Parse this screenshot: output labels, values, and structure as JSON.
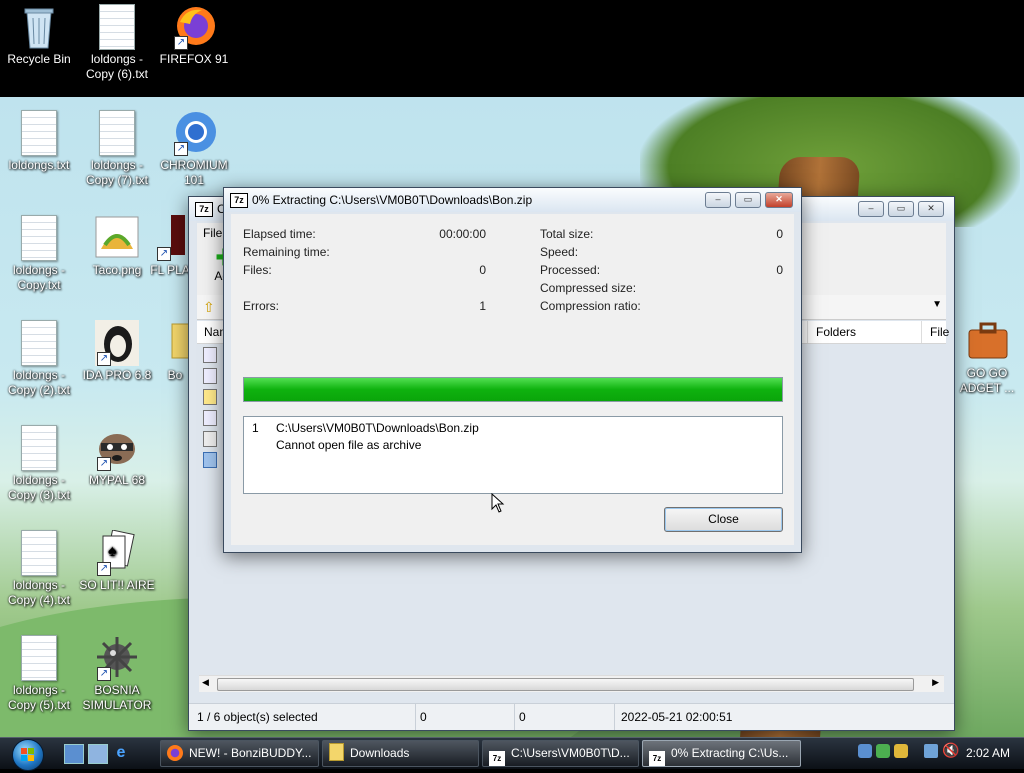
{
  "desktop": {
    "icons": [
      {
        "label": "Recycle Bin",
        "icon": "recycle-bin-icon"
      },
      {
        "label": "loldongs - Copy (6).txt",
        "icon": "text-file-icon"
      },
      {
        "label": "FIREFOX 91",
        "icon": "firefox-icon"
      },
      {
        "label": "loldongs.txt",
        "icon": "text-file-icon"
      },
      {
        "label": "loldongs - Copy (7).txt",
        "icon": "text-file-icon"
      },
      {
        "label": "CHROMIUM 101",
        "icon": "chromium-icon"
      },
      {
        "label": "loldongs - Copy.txt",
        "icon": "text-file-icon"
      },
      {
        "label": "Taco.png",
        "icon": "image-file-icon"
      },
      {
        "label": "FL PLA",
        "icon": "app-icon"
      },
      {
        "label": "loldongs - Copy (2).txt",
        "icon": "text-file-icon"
      },
      {
        "label": "IDA PRO 6.8",
        "icon": "ida-pro-icon"
      },
      {
        "label": "Bo",
        "icon": "folder-icon"
      },
      {
        "label": "loldongs - Copy (3).txt",
        "icon": "text-file-icon"
      },
      {
        "label": "MYPAL 68",
        "icon": "mypal-icon"
      },
      {
        "label": "loldongs - Copy (4).txt",
        "icon": "text-file-icon"
      },
      {
        "label": "SO LIT!! AIRE",
        "icon": "solitaire-icon"
      },
      {
        "label": "loldongs - Copy (5).txt",
        "icon": "text-file-icon"
      },
      {
        "label": "BOSNIA SIMULATOR",
        "icon": "minesweeper-icon"
      },
      {
        "label": "GO GO ADGET ...",
        "icon": "briefcase-icon"
      }
    ]
  },
  "bg_window": {
    "title_initial": "C",
    "menu_first": "File",
    "toolbar_add": "Add",
    "header_name": "Nam",
    "header_folders": "Folders",
    "header_files": "File",
    "status": {
      "selection": "1 / 6 object(s) selected",
      "size": "0",
      "packed": "0",
      "modified": "2022-05-21 02:00:51"
    }
  },
  "dialog": {
    "app_icon": "7z",
    "title": "0% Extracting C:\\Users\\VM0B0T\\Downloads\\Bon.zip",
    "left_stats": [
      {
        "label": "Elapsed time:",
        "value": "00:00:00"
      },
      {
        "label": "Remaining time:",
        "value": ""
      },
      {
        "label": "Files:",
        "value": "0"
      },
      {
        "label": "",
        "value": ""
      },
      {
        "label": "Errors:",
        "value": "1"
      }
    ],
    "right_stats": [
      {
        "label": "Total size:",
        "value": "0"
      },
      {
        "label": "Speed:",
        "value": ""
      },
      {
        "label": "Processed:",
        "value": "0"
      },
      {
        "label": "Compressed size:",
        "value": ""
      },
      {
        "label": "Compression ratio:",
        "value": ""
      }
    ],
    "progress_fraction": 1.0,
    "messages": [
      {
        "index": "1",
        "path": "C:\\Users\\VM0B0T\\Downloads\\Bon.zip",
        "error": "Cannot open file as archive"
      }
    ],
    "close_label": "Close"
  },
  "taskbar": {
    "buttons": [
      {
        "label": "NEW! - BonziBUDDY...",
        "icon": "firefox-icon",
        "active": false
      },
      {
        "label": "Downloads",
        "icon": "folder-icon",
        "active": false
      },
      {
        "label": "C:\\Users\\VM0B0T\\D...",
        "icon": "7zip-icon",
        "active": false
      },
      {
        "label": "0% Extracting C:\\Us...",
        "icon": "7zip-icon",
        "active": true
      }
    ],
    "clock": "2:02 AM"
  },
  "colors": {
    "progress_green": "#0fb20f",
    "taskbar_dark": "#0c1016",
    "close_red": "#c2412b"
  }
}
